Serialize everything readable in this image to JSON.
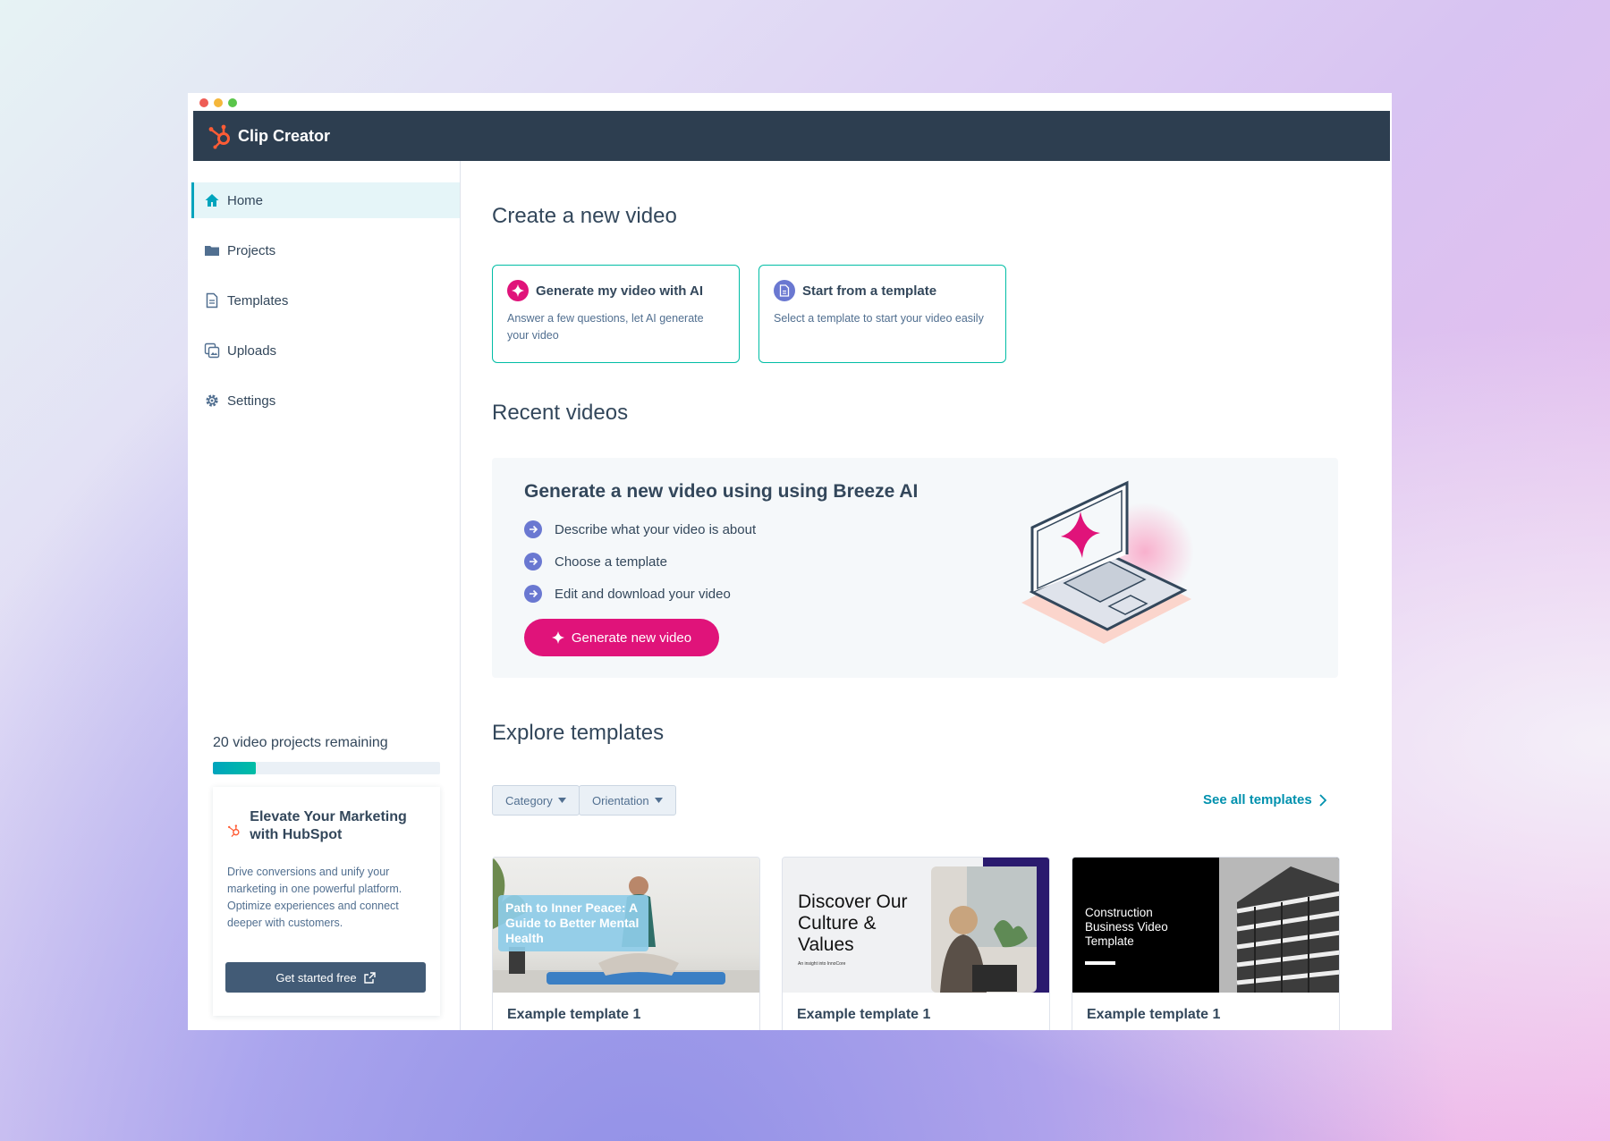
{
  "app": {
    "title": "Clip Creator"
  },
  "sidebar": {
    "items": [
      {
        "label": "Home",
        "icon": "home-icon"
      },
      {
        "label": "Projects",
        "icon": "folder-icon"
      },
      {
        "label": "Templates",
        "icon": "document-icon"
      },
      {
        "label": "Uploads",
        "icon": "uploads-icon"
      },
      {
        "label": "Settings",
        "icon": "gear-icon"
      }
    ],
    "quota_label": "20 video projects remaining",
    "quota_fraction": 0.19,
    "promo": {
      "title": "Elevate Your Marketing with HubSpot",
      "body": "Drive conversions and unify your marketing in one powerful platform. Optimize experiences and connect deeper with customers.",
      "button": "Get started free"
    }
  },
  "main": {
    "create_heading": "Create a new video",
    "create_cards": [
      {
        "title": "Generate my video with AI",
        "desc": "Answer a few questions, let AI generate your video"
      },
      {
        "title": "Start from a template",
        "desc": "Select a template to start your video easily"
      }
    ],
    "recent_heading": "Recent videos",
    "breeze": {
      "title": "Generate a new video using using Breeze AI",
      "steps": [
        "Describe what your video is about",
        "Choose a template",
        "Edit and download your video"
      ],
      "button": "Generate new video"
    },
    "explore_heading": "Explore templates",
    "filters": [
      "Category",
      "Orientation"
    ],
    "see_all": "See all templates",
    "templates": [
      {
        "name": "Example template 1",
        "thumb_text": "Path to Inner Peace: A Guide to Better Mental Health"
      },
      {
        "name": "Example template 1",
        "thumb_text": "Discover Our Culture & Values",
        "thumb_sub": "An insight into InnoCore"
      },
      {
        "name": "Example template 1",
        "thumb_text": "Construction Business Video Template"
      }
    ]
  },
  "colors": {
    "topbar": "#2d3e50",
    "accent_teal": "#00a4bd",
    "accent_pink": "#e0137a",
    "accent_purple": "#6a78d1",
    "hubspot_orange": "#ff5c35"
  }
}
